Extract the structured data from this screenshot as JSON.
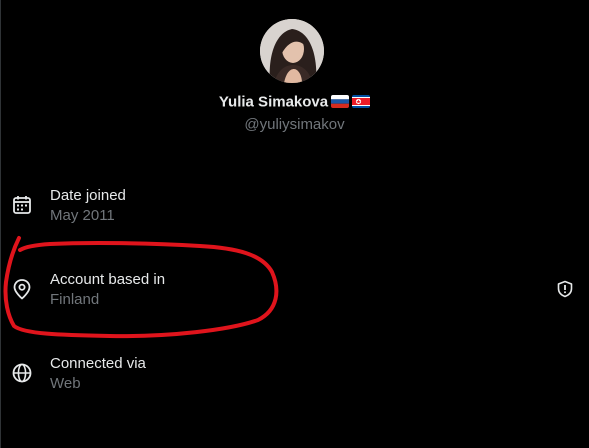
{
  "profile": {
    "display_name": "Yulia Simakova",
    "handle": "@yuliysimakov",
    "flags": [
      "russia-flag-icon",
      "north-korea-flag-icon"
    ]
  },
  "about": {
    "items": [
      {
        "icon": "calendar-icon",
        "label": "Date joined",
        "value": "May 2011"
      },
      {
        "icon": "location-pin-icon",
        "label": "Account based in",
        "value": "Finland",
        "badge_icon": "shield-alert-icon"
      },
      {
        "icon": "globe-icon",
        "label": "Connected via",
        "value": "Web"
      }
    ]
  },
  "colors": {
    "background": "#000000",
    "primary_text": "#e7e9ea",
    "secondary_text": "#71767b",
    "annotation": "#e0141c"
  }
}
